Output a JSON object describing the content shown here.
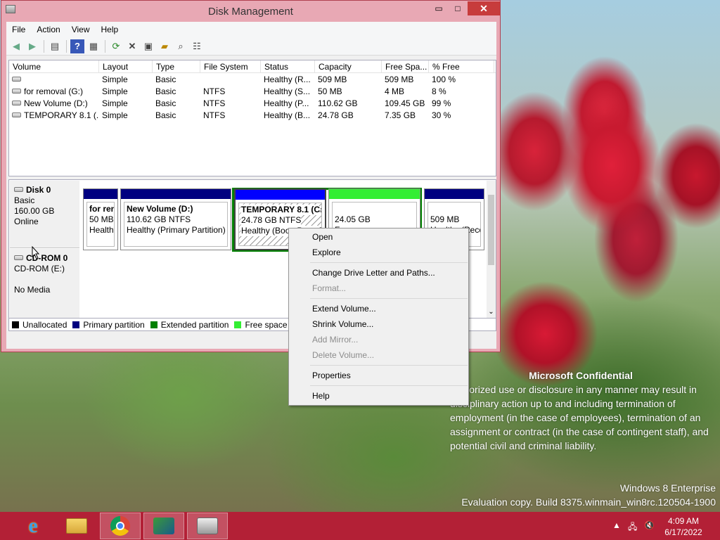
{
  "window": {
    "title": "Disk Management",
    "min": "▭",
    "max": "□",
    "close": "✕"
  },
  "menu": [
    "File",
    "Action",
    "View",
    "Help"
  ],
  "columns": [
    "Volume",
    "Layout",
    "Type",
    "File System",
    "Status",
    "Capacity",
    "Free Spa...",
    "% Free"
  ],
  "volumes": [
    {
      "volume": "",
      "layout": "Simple",
      "type": "Basic",
      "fs": "",
      "status": "Healthy (R...",
      "capacity": "509 MB",
      "free": "509 MB",
      "pct": "100 %"
    },
    {
      "volume": "for removal (G:)",
      "layout": "Simple",
      "type": "Basic",
      "fs": "NTFS",
      "status": "Healthy (S...",
      "capacity": "50 MB",
      "free": "4 MB",
      "pct": "8 %"
    },
    {
      "volume": "New Volume (D:)",
      "layout": "Simple",
      "type": "Basic",
      "fs": "NTFS",
      "status": "Healthy (P...",
      "capacity": "110.62 GB",
      "free": "109.45 GB",
      "pct": "99 %"
    },
    {
      "volume": "TEMPORARY 8.1 (...",
      "layout": "Simple",
      "type": "Basic",
      "fs": "NTFS",
      "status": "Healthy (B...",
      "capacity": "24.78 GB",
      "free": "7.35 GB",
      "pct": "30 %"
    }
  ],
  "disk0": {
    "name": "Disk 0",
    "type": "Basic",
    "size": "160.00 GB",
    "state": "Online"
  },
  "cdrom": {
    "name": "CD-ROM 0",
    "drive": "CD-ROM (E:)",
    "media": "No Media"
  },
  "partitions": {
    "p1": {
      "name": "for ren",
      "size": "50 MB",
      "status": "Healthy"
    },
    "p2": {
      "name": "New Volume  (D:)",
      "size": "110.62 GB NTFS",
      "status": "Healthy (Primary Partition)"
    },
    "p3": {
      "name": "TEMPORARY 8.1  (C:)",
      "size": "24.78 GB NTFS",
      "status": "Healthy (Boot, Page Fi"
    },
    "p4": {
      "size": "24.05 GB",
      "status": "Free space"
    },
    "p5": {
      "size": "509 MB",
      "status": "Healthy (Reco"
    }
  },
  "legend": [
    "Unallocated",
    "Primary partition",
    "Extended partition",
    "Free space"
  ],
  "context_menu": {
    "open": "Open",
    "explore": "Explore",
    "change": "Change Drive Letter and Paths...",
    "format": "Format...",
    "extend": "Extend Volume...",
    "shrink": "Shrink Volume...",
    "mirror": "Add Mirror...",
    "delete": "Delete Volume...",
    "properties": "Properties",
    "help": "Help"
  },
  "watermark": {
    "title": "Microsoft Confidential",
    "body": "authorized use or disclosure in any manner may result in disciplinary action up to and including termination of employment (in the case of employees), termination of an assignment or contract (in the case of contingent staff), and potential civil and criminal liability.",
    "edition": "Windows 8 Enterprise",
    "build": "Evaluation copy. Build 8375.winmain_win8rc.120504-1900"
  },
  "clock": {
    "time": "4:09 AM",
    "date": "6/17/2022"
  },
  "colors": {
    "unallocated": "#000000",
    "primary": "#000080",
    "extended": "#008000",
    "free": "#33ee33",
    "logical": "#0000ff"
  }
}
